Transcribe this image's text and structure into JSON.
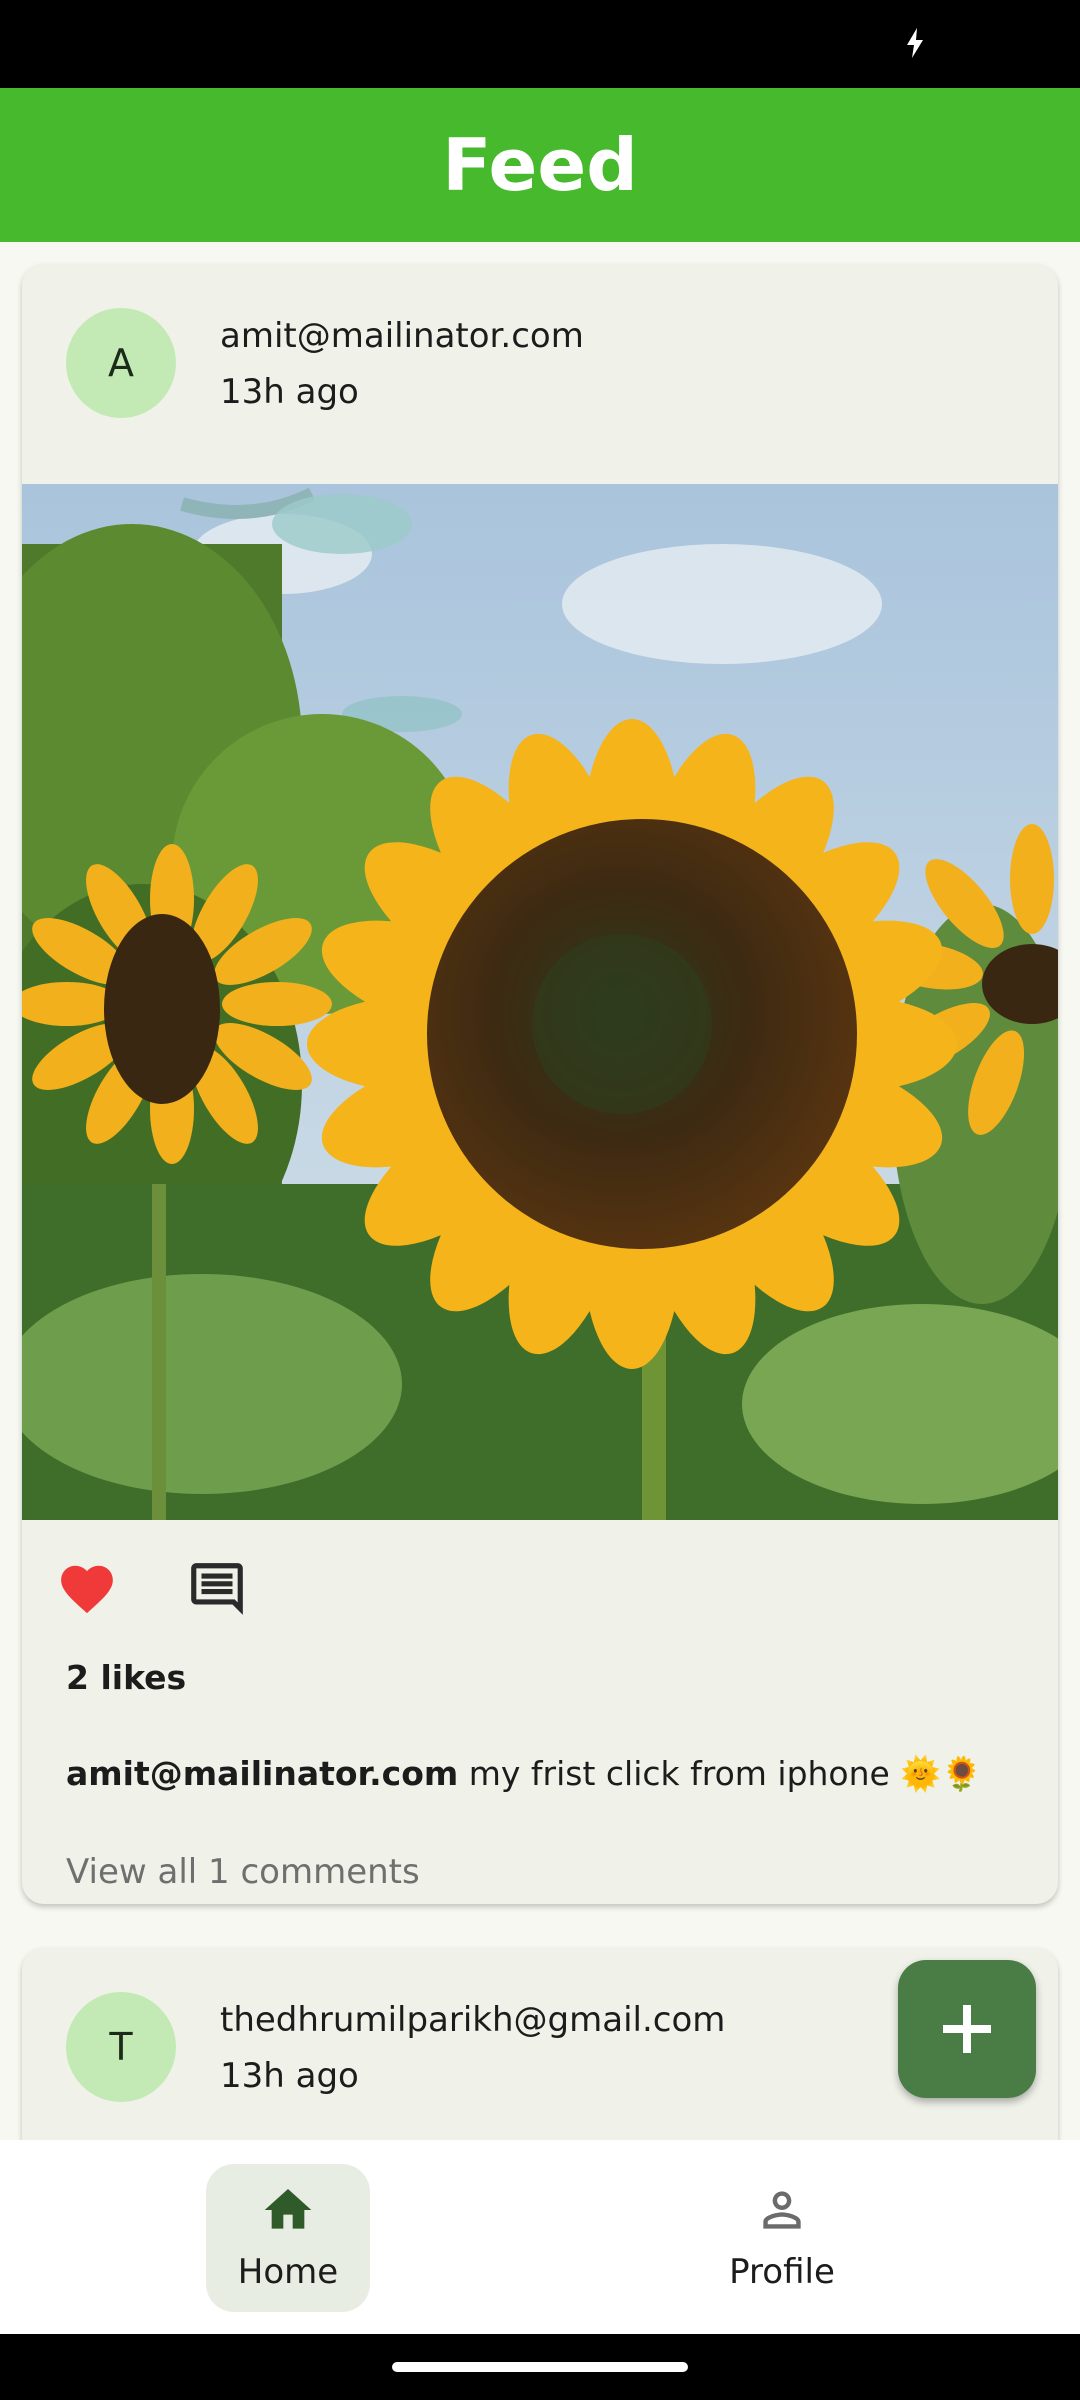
{
  "app_bar": {
    "title": "Feed"
  },
  "posts": [
    {
      "avatar_letter": "A",
      "author": "amit@mailinator.com",
      "time": "13h ago",
      "likes_text": "2 likes",
      "caption_user": "amit@mailinator.com",
      "caption_text": " my frist click from iphone 🌞🌻",
      "view_comments": "View all 1 comments",
      "liked": true
    },
    {
      "avatar_letter": "T",
      "author": "thedhrumilparikh@gmail.com",
      "time": "13h ago"
    }
  ],
  "nav": {
    "items": [
      {
        "label": "Home",
        "icon": "home-icon",
        "selected": true
      },
      {
        "label": "Profile",
        "icon": "person-icon",
        "selected": false
      }
    ]
  },
  "colors": {
    "app_bar": "#46b92c",
    "avatar": "#c3eab4",
    "like": "#f03a3a",
    "fab": "#4a7c45"
  }
}
